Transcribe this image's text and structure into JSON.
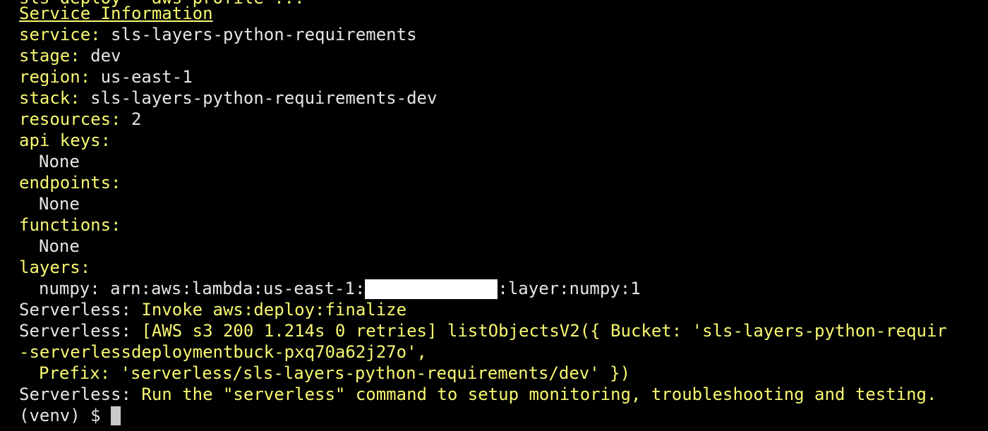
{
  "terminal": {
    "clipped_top_line": "sls deploy --aws-profile ...",
    "heading": "Service Information",
    "service_label": "service:",
    "service_value": "sls-layers-python-requirements",
    "stage_label": "stage:",
    "stage_value": "dev",
    "region_label": "region:",
    "region_value": "us-east-1",
    "stack_label": "stack:",
    "stack_value": "sls-layers-python-requirements-dev",
    "resources_label": "resources:",
    "resources_value": "2",
    "api_keys_label": "api keys:",
    "api_keys_value": "None",
    "endpoints_label": "endpoints:",
    "endpoints_value": "None",
    "functions_label": "functions:",
    "functions_value": "None",
    "layers_label": "layers:",
    "layer_name": "numpy: ",
    "layer_arn_prefix": "arn:aws:lambda:us-east-1:",
    "layer_arn_suffix": ":layer:numpy:1",
    "log1_prefix": "Serverless: ",
    "log1_text": "Invoke aws:deploy:finalize",
    "log2_prefix": "Serverless: ",
    "log2_text": "[AWS s3 200 1.214s 0 retries] listObjectsV2({ Bucket: 'sls-layers-python-requir",
    "log2_cont1": "-serverlessdeploymentbuck-pxq70a62j27o',",
    "log2_cont2": "Prefix: 'serverless/sls-layers-python-requirements/dev' })",
    "log3_prefix": "Serverless: ",
    "log3_text": "Run the \"serverless\" command to setup monitoring, troubleshooting and testing.",
    "prompt": "(venv) $ "
  },
  "colors": {
    "background": "#000000",
    "yellow": "#f9f871",
    "white": "#e6e6e6",
    "redaction": "#ffffff"
  }
}
